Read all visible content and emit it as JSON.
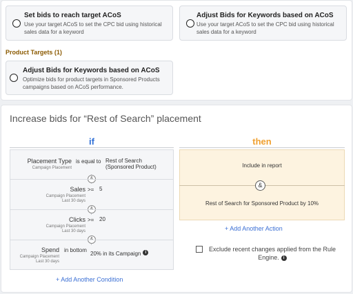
{
  "options_top": [
    {
      "title": "Set bids to reach target ACoS",
      "desc": "Use your target ACoS to set the CPC bid using historical sales data for a keyword"
    },
    {
      "title": "Adjust Bids for Keywords based on ACoS",
      "desc": "Use your target ACoS to set the CPC bid using historical sales data for a keyword"
    }
  ],
  "product_targets": {
    "label": "Product Targets (1)",
    "option": {
      "title": "Adjust Bids for Keywords based on ACoS",
      "desc": "Optimize bids for product targets in Sponsored Products campaigns based on ACoS performance."
    }
  },
  "rule": {
    "title": "Increase bids for “Rest of Search” placement",
    "if_label": "if",
    "then_label": "then",
    "and_symbol": "&",
    "conditions": [
      {
        "name": "Placement Type",
        "sub1": "Campaign Placement",
        "sub2": "",
        "op": "is equal to",
        "value1": "Rest of Search",
        "value2": "(Sponsored Product)"
      },
      {
        "name": "Sales",
        "sub1": "Campaign Placement",
        "sub2": "Last 30 days",
        "op": ">=",
        "value1": "5",
        "value2": ""
      },
      {
        "name": "Clicks",
        "sub1": "Campaign Placement",
        "sub2": "Last 30 days",
        "op": ">=",
        "value1": "20",
        "value2": ""
      },
      {
        "name": "Spend",
        "sub1": "Campaign Placement",
        "sub2": "Last 30 days",
        "op": "in bottom",
        "value1": "20% in its Campaign",
        "value2": ""
      }
    ],
    "info_glyph": "i",
    "actions": [
      "Include in report",
      "Rest of Search for Sponsored Product by 10%"
    ],
    "add_condition": "+ Add Another Condition",
    "add_action": "+ Add Another Action",
    "exclude_label": "Exclude recent changes applied from the Rule Engine."
  },
  "colors": {
    "if": "#2f6fd6",
    "then": "#f0a030",
    "section_label": "#8b5a00",
    "link": "#3b6fd4",
    "then_bg": "#fdf3e0"
  }
}
